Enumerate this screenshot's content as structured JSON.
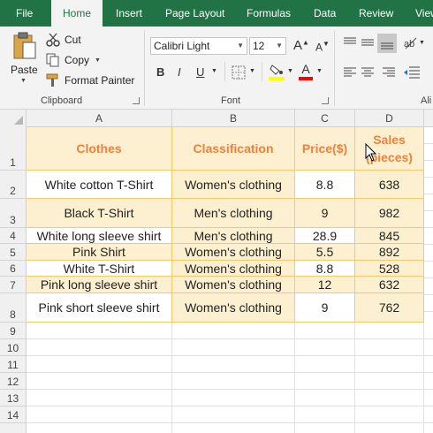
{
  "menu": {
    "tabs": [
      "File",
      "Home",
      "Insert",
      "Page Layout",
      "Formulas",
      "Data",
      "Review",
      "View"
    ],
    "active": "Home"
  },
  "ribbon": {
    "clipboard": {
      "paste_label": "Paste",
      "cut_label": "Cut",
      "copy_label": "Copy",
      "format_painter_label": "Format Painter",
      "group_label": "Clipboard"
    },
    "font": {
      "font_name": "Calibri Light",
      "font_size": "12",
      "bold": "B",
      "italic": "I",
      "underline": "U",
      "grow": "A",
      "shrink": "A",
      "font_color_letter": "A",
      "group_label": "Font",
      "fill_color": "#ffff00",
      "font_color": "#ff0000"
    },
    "alignment": {
      "group_label": "Ali"
    }
  },
  "sheet": {
    "columns": [
      "A",
      "B",
      "C",
      "D"
    ],
    "rows": [
      "1",
      "2",
      "3",
      "4",
      "5",
      "6",
      "7",
      "8",
      "9",
      "10",
      "11",
      "12",
      "13",
      "14"
    ],
    "header": {
      "a": "Clothes",
      "b": "Classification",
      "c": "Price($)",
      "d1": "Sales",
      "d2": "(pieces)"
    },
    "data": [
      {
        "clothes": "White cotton T-Shirt",
        "classification": "Women's clothing",
        "price": "8.8",
        "sales": "638"
      },
      {
        "clothes": "Black T-Shirt",
        "classification": "Men's clothing",
        "price": "9",
        "sales": "982"
      },
      {
        "clothes": "White long sleeve shirt",
        "classification": "Men's clothing",
        "price": "28.9",
        "sales": "845"
      },
      {
        "clothes": "Pink Shirt",
        "classification": "Women's clothing",
        "price": "5.5",
        "sales": "892"
      },
      {
        "clothes": "White T-Shirt",
        "classification": "Women's clothing",
        "price": "8.8",
        "sales": "528"
      },
      {
        "clothes": "Pink long sleeve shirt",
        "classification": "Women's clothing",
        "price": "12",
        "sales": "632"
      },
      {
        "clothes": "Pink short sleeve shirt",
        "classification": "Women's clothing",
        "price": "9",
        "sales": "762"
      }
    ],
    "colors": {
      "header_text": "#f0813c",
      "highlight": "#fdf0d0",
      "border": "#f5c96a"
    }
  }
}
